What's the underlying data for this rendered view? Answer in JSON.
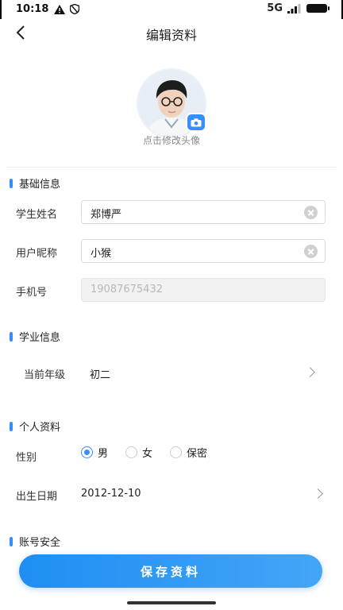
{
  "status_bar": {
    "time": "10:18",
    "network": "5G"
  },
  "header": {
    "title": "编辑资料"
  },
  "avatar": {
    "hint": "点击修改头像"
  },
  "sections": {
    "basic": {
      "title": "基础信息",
      "student_name_label": "学生姓名",
      "student_name_value": "郑博严",
      "nickname_label": "用户昵称",
      "nickname_value": "小猴",
      "phone_label": "手机号",
      "phone_value": "19087675432"
    },
    "academic": {
      "title": "学业信息",
      "grade_label": "当前年级",
      "grade_value": "初二"
    },
    "personal": {
      "title": "个人资料",
      "gender_label": "性别",
      "gender_options": [
        "男",
        "女",
        "保密"
      ],
      "gender_selected": "男",
      "birthday_label": "出生日期",
      "birthday_value": "2012-12-10"
    },
    "account": {
      "title": "账号安全"
    }
  },
  "footer": {
    "save_label": "保存资料"
  },
  "colors": {
    "accent": "#3a8ef7"
  },
  "icons": [
    "back-icon",
    "camera-icon",
    "clear-icon",
    "chevron-right-icon"
  ]
}
